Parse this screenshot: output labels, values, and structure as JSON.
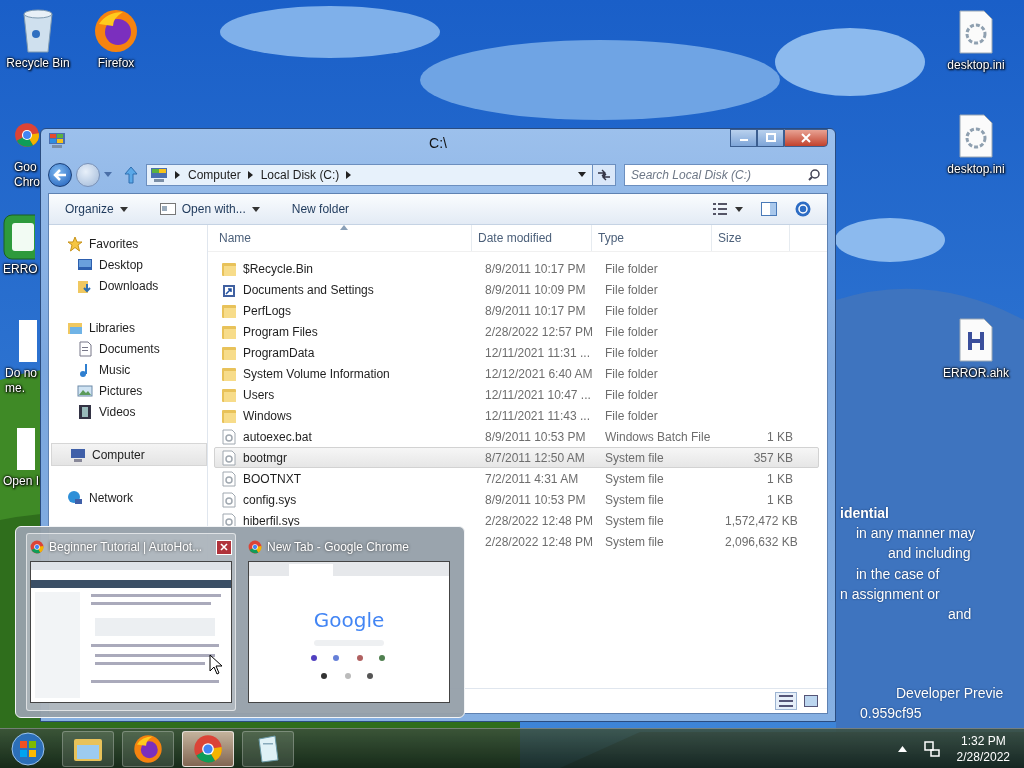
{
  "desktop_icons": [
    {
      "kind": "recycle",
      "lines": [
        "Recycle Bin"
      ]
    },
    {
      "kind": "firefox",
      "lines": [
        "Firefox"
      ]
    },
    {
      "kind": "chrome",
      "lines": [
        "Goo",
        "Chro"
      ]
    },
    {
      "kind": "ahk",
      "lines": [
        "ERRO"
      ]
    },
    {
      "kind": "blank",
      "lines": [
        "Do no",
        "me."
      ]
    },
    {
      "kind": "blank",
      "lines": [
        "Open I"
      ]
    },
    {
      "kind": "ini",
      "lines": [
        "desktop.ini"
      ]
    },
    {
      "kind": "ini",
      "lines": [
        "desktop.ini"
      ]
    },
    {
      "kind": "ahkfile",
      "lines": [
        "ERROR.ahk"
      ]
    }
  ],
  "wallpaper_text": [
    {
      "text": "idential",
      "bold": true
    },
    {
      "text": "in any manner may",
      "bold": false
    },
    {
      "text": "and including",
      "bold": false
    },
    {
      "text": "in the case of",
      "bold": false
    },
    {
      "text": "n assignment or",
      "bold": false
    },
    {
      "text": "and",
      "bold": false
    },
    {
      "text": "Developer Previe",
      "bold": false
    },
    {
      "text": "0.959cf95",
      "bold": false
    }
  ],
  "explorer": {
    "title": "C:\\",
    "breadcrumb": [
      "Computer",
      "Local Disk (C:)"
    ],
    "search": {
      "placeholder": "Search Local Disk (C:)"
    },
    "toolbar": [
      {
        "label": "Organize",
        "dropdown": true
      },
      {
        "label": "Open with...",
        "dropdown": true
      },
      {
        "label": "New folder",
        "dropdown": false
      }
    ],
    "navigation": [
      {
        "label": "Favorites",
        "kind": "star",
        "selected": false,
        "children": [
          {
            "label": "Desktop",
            "kind": "desktop",
            "selected": false
          },
          {
            "label": "Downloads",
            "kind": "downloads",
            "selected": false
          }
        ]
      },
      {
        "label": "Libraries",
        "kind": "library",
        "selected": false,
        "children": [
          {
            "label": "Documents",
            "kind": "documents",
            "selected": false
          },
          {
            "label": "Music",
            "kind": "music",
            "selected": false
          },
          {
            "label": "Pictures",
            "kind": "pictures",
            "selected": false
          },
          {
            "label": "Videos",
            "kind": "videos",
            "selected": false
          }
        ]
      },
      {
        "label": "Computer",
        "kind": "computer",
        "selected": true
      },
      {
        "label": "Network",
        "kind": "network",
        "selected": false
      }
    ],
    "columns": [
      "Name",
      "Date modified",
      "Type",
      "Size"
    ],
    "rows": [
      {
        "kind": "folder",
        "name": "$Recycle.Bin",
        "date": "8/9/2011 10:17 PM",
        "type": "File folder",
        "selected": false
      },
      {
        "kind": "link",
        "name": "Documents and Settings",
        "date": "8/9/2011 10:09 PM",
        "type": "File folder",
        "selected": false
      },
      {
        "kind": "folder",
        "name": "PerfLogs",
        "date": "8/9/2011 10:17 PM",
        "type": "File folder",
        "selected": false
      },
      {
        "kind": "folder",
        "name": "Program Files",
        "date": "2/28/2022 12:57 PM",
        "type": "File folder",
        "selected": false
      },
      {
        "kind": "folder",
        "name": "ProgramData",
        "date": "12/11/2021 11:31 ...",
        "type": "File folder",
        "selected": false
      },
      {
        "kind": "folder",
        "name": "System Volume Information",
        "date": "12/12/2021 6:40 AM",
        "type": "File folder",
        "selected": false
      },
      {
        "kind": "folder",
        "name": "Users",
        "date": "12/11/2021 10:47 ...",
        "type": "File folder",
        "selected": false
      },
      {
        "kind": "folder",
        "name": "Windows",
        "date": "12/11/2021 11:43 ...",
        "type": "File folder",
        "selected": false
      },
      {
        "kind": "file",
        "name": "autoexec.bat",
        "date": "8/9/2011 10:53 PM",
        "type": "Windows Batch File",
        "size": "1 KB",
        "selected": false
      },
      {
        "kind": "file",
        "name": "bootmgr",
        "date": "8/7/2011 12:50 AM",
        "type": "System file",
        "size": "357 KB",
        "selected": true
      },
      {
        "kind": "file",
        "name": "BOOTNXT",
        "date": "7/2/2011 4:31 AM",
        "type": "System file",
        "size": "1 KB",
        "selected": false
      },
      {
        "kind": "file",
        "name": "config.sys",
        "date": "8/9/2011 10:53 PM",
        "type": "System file",
        "size": "1 KB",
        "selected": false
      },
      {
        "kind": "file",
        "name": "hiberfil.sys",
        "date": "2/28/2022 12:48 PM",
        "type": "System file",
        "size": "1,572,472 KB",
        "selected": false
      },
      {
        "date": "2/28/2022 12:48 PM",
        "type": "System file",
        "size": "2,096,632 KB",
        "selected": false
      }
    ]
  },
  "thumbnails": [
    {
      "kind": "tutorial",
      "title": "Beginner Tutorial | AutoHot...",
      "selected": true
    },
    {
      "kind": "newtab",
      "title": "New Tab - Google Chrome",
      "selected": false,
      "preview_logo": "Google"
    }
  ],
  "taskbar": {
    "items": [
      {
        "kind": "explorer",
        "selected": false
      },
      {
        "kind": "firefox",
        "selected": false
      },
      {
        "kind": "chrome",
        "selected": true
      },
      {
        "kind": "notepad",
        "selected": false
      }
    ],
    "time": "1:32 PM",
    "date": "2/28/2022"
  }
}
